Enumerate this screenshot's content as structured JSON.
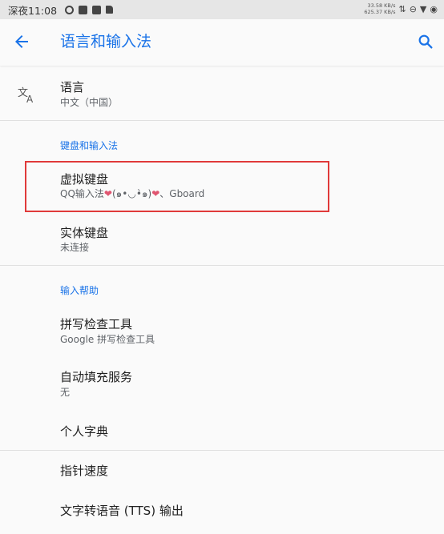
{
  "status_bar": {
    "time": "深夜11:08",
    "net_up": "33.58 KB/s",
    "net_down": "625.37 KB/s",
    "icons": [
      "notification-icon",
      "app-icon",
      "app-icon",
      "sd-card-icon",
      "data-arrows-icon",
      "dnd-icon",
      "wifi-icon",
      "battery-icon"
    ]
  },
  "appbar": {
    "title": "语言和输入法",
    "back_icon": "arrow-back-icon",
    "search_icon": "search-icon"
  },
  "language": {
    "title": "语言",
    "subtitle": "中文（中国）",
    "icon": "translate-icon"
  },
  "keyboard_section": {
    "header": "键盘和输入法",
    "virtual_keyboard": {
      "title": "虚拟键盘",
      "subtitle_prefix": "QQ输入法",
      "subtitle_heart1": "❤",
      "subtitle_face": "(๑•◡•̀๑)",
      "subtitle_heart2": "❤",
      "subtitle_suffix": "、Gboard"
    },
    "physical_keyboard": {
      "title": "实体键盘",
      "subtitle": "未连接"
    }
  },
  "input_help_section": {
    "header": "输入帮助",
    "spell_checker": {
      "title": "拼写检查工具",
      "subtitle": "Google 拼写检查工具"
    },
    "autofill": {
      "title": "自动填充服务",
      "subtitle": "无"
    },
    "personal_dictionary": {
      "title": "个人字典"
    }
  },
  "pointer_speed": {
    "title": "指针速度"
  },
  "tts": {
    "title": "文字转语音 (TTS) 输出"
  },
  "colors": {
    "accent": "#1a73e8",
    "highlight_border": "#e03a3a",
    "background": "#fafafa"
  }
}
